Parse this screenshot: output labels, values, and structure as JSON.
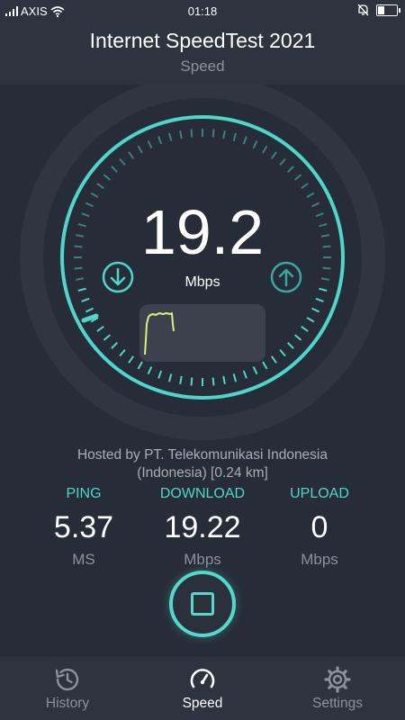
{
  "status_bar": {
    "carrier": "AXIS",
    "time": "01:18",
    "battery_level": 0.4
  },
  "header": {
    "title": "Internet SpeedTest 2021",
    "subtitle": "Speed"
  },
  "gauge": {
    "value": "19.2",
    "unit": "Mbps",
    "download_icon": "arrow-down-circle-icon",
    "upload_icon": "arrow-up-circle-icon",
    "accent_color": "#4fd6c9",
    "graph_color": "#d7f27a"
  },
  "host": {
    "line1": "Hosted by PT. Telekomunikasi Indonesia",
    "line2": "(Indonesia) [0.24 km]"
  },
  "stats": [
    {
      "label": "PING",
      "value": "5.37",
      "unit": "MS"
    },
    {
      "label": "DOWNLOAD",
      "value": "19.22",
      "unit": "Mbps"
    },
    {
      "label": "UPLOAD",
      "value": "0",
      "unit": "Mbps"
    }
  ],
  "stop_button": {
    "icon": "stop-icon"
  },
  "nav": [
    {
      "label": "History",
      "icon": "history-icon",
      "active": false
    },
    {
      "label": "Speed",
      "icon": "speedometer-icon",
      "active": true
    },
    {
      "label": "Settings",
      "icon": "gear-icon",
      "active": false
    }
  ]
}
